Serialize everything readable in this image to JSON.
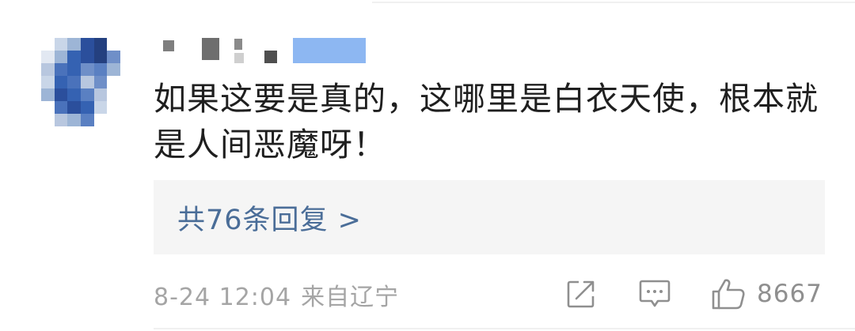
{
  "comment": {
    "username": "",
    "text": "如果这要是真的，这哪里是白衣天使，根本就是人间恶魔呀！",
    "replies_label": "共76条回复 >",
    "date": "8-24 12:04",
    "source": "来自辽宁",
    "like_count": "8667"
  },
  "icons": {
    "share": "share-icon",
    "comment": "comment-icon",
    "like": "thumbs-up-icon"
  },
  "colors": {
    "text": "#1f1f1f",
    "link": "#4a6d98",
    "meta": "#a5a5a5",
    "reply_bg": "#f5f5f5"
  }
}
